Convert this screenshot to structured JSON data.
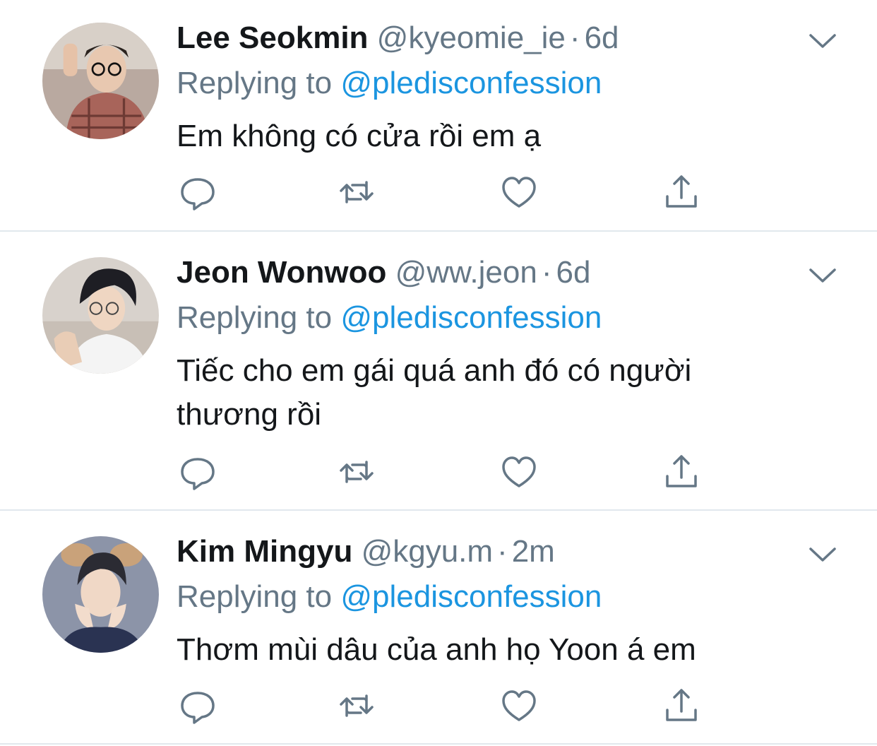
{
  "colors": {
    "name": "#14171a",
    "muted": "#657786",
    "link": "#1b95e0",
    "divider": "#e1e8ed",
    "icon": "#657786"
  },
  "tweets": [
    {
      "name": "Lee Seokmin",
      "handle": "@kyeomie_ie",
      "separator": "·",
      "time": "6d",
      "replying_prefix": "Replying to",
      "replying_to": "@pledisconfession",
      "text": "Em không có cửa rồi em ạ"
    },
    {
      "name": "Jeon Wonwoo",
      "handle": "@ww.jeon",
      "separator": "·",
      "time": "6d",
      "replying_prefix": "Replying to",
      "replying_to": "@pledisconfession",
      "text": "Tiếc cho em gái quá anh đó có người thương rồi"
    },
    {
      "name": "Kim Mingyu",
      "handle": "@kgyu.m",
      "separator": "·",
      "time": "2m",
      "replying_prefix": "Replying to",
      "replying_to": "@pledisconfession",
      "text": "Thơm mùi dâu của anh họ Yoon á em"
    }
  ],
  "icons": {
    "caret": "chevron-down-icon",
    "reply": "reply-icon",
    "retweet": "retweet-icon",
    "like": "heart-icon",
    "share": "share-icon"
  }
}
